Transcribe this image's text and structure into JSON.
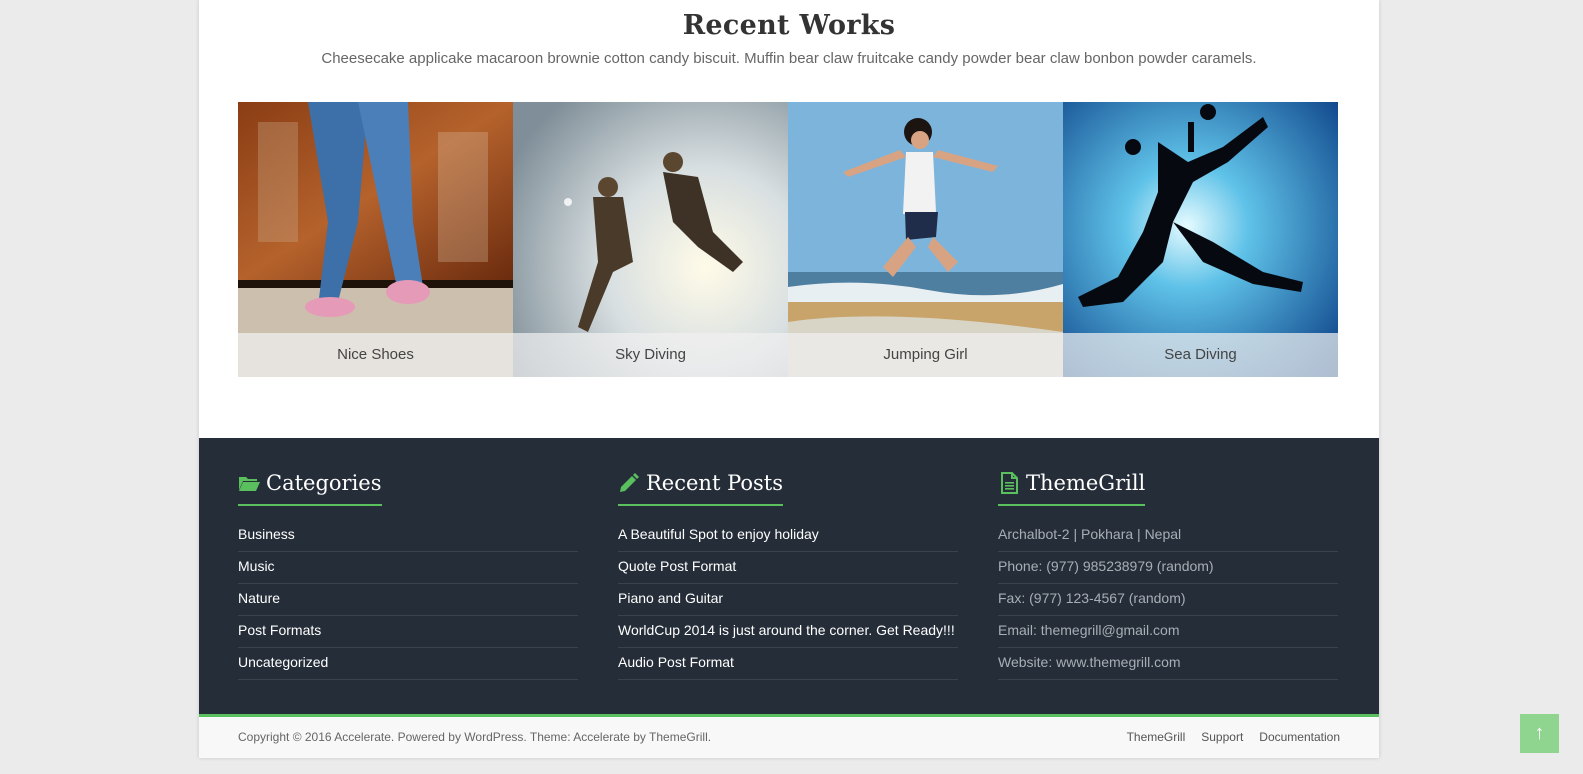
{
  "recent_works": {
    "title": "Recent Works",
    "description": "Cheesecake applicake macaroon brownie cotton candy biscuit. Muffin bear claw fruitcake candy powder bear claw bonbon powder caramels.",
    "items": [
      {
        "caption": "Nice Shoes"
      },
      {
        "caption": "Sky Diving"
      },
      {
        "caption": "Jumping Girl"
      },
      {
        "caption": "Sea Diving"
      }
    ]
  },
  "footer": {
    "categories": {
      "title": "Categories",
      "items": [
        "Business",
        "Music",
        "Nature",
        "Post Formats",
        "Uncategorized"
      ]
    },
    "recent_posts": {
      "title": "Recent Posts",
      "items": [
        "A Beautiful Spot to enjoy holiday",
        "Quote Post Format",
        "Piano and Guitar",
        "WorldCup 2014 is just around the corner. Get Ready!!!",
        "Audio Post Format"
      ]
    },
    "themegrill": {
      "title": "ThemeGrill",
      "items": [
        "Archalbot-2 | Pokhara | Nepal",
        "Phone: (977) 985238979 (random)",
        "Fax: (977) 123-4567 (random)",
        "Email: themegrill@gmail.com",
        "Website: www.themegrill.com"
      ]
    }
  },
  "bottom_bar": {
    "copyright": "Copyright © 2016 Accelerate. Powered by WordPress. Theme: Accelerate by ThemeGrill.",
    "links": [
      "ThemeGrill",
      "Support",
      "Documentation"
    ]
  },
  "scroll_top": {
    "icon": "arrow-up-icon",
    "glyph": "↑"
  },
  "colors": {
    "accent": "#5ac05e",
    "footer_bg": "#252d38"
  }
}
